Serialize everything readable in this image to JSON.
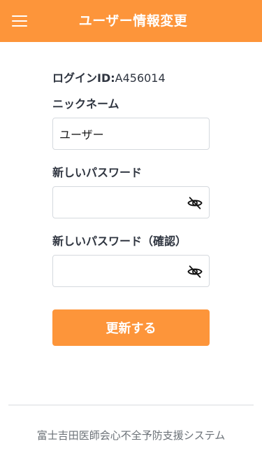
{
  "header": {
    "title": "ユーザー情報変更",
    "menu_icon": "hamburger-menu-icon",
    "background_color": "#fd953a"
  },
  "form": {
    "login_id_label": "ログインID:",
    "login_id_value": "A456014",
    "nickname_label": "ニックネーム",
    "nickname_value": "ユーザー",
    "new_password_label": "新しいパスワード",
    "new_password_value": "",
    "confirm_password_label": "新しいパスワード（確認）",
    "confirm_password_value": "",
    "password_toggle_icon": "eye-slash-icon",
    "submit_label": "更新する",
    "accent_color": "#fd953a"
  },
  "footer": {
    "text": "富士吉田医師会心不全予防支援システム"
  }
}
